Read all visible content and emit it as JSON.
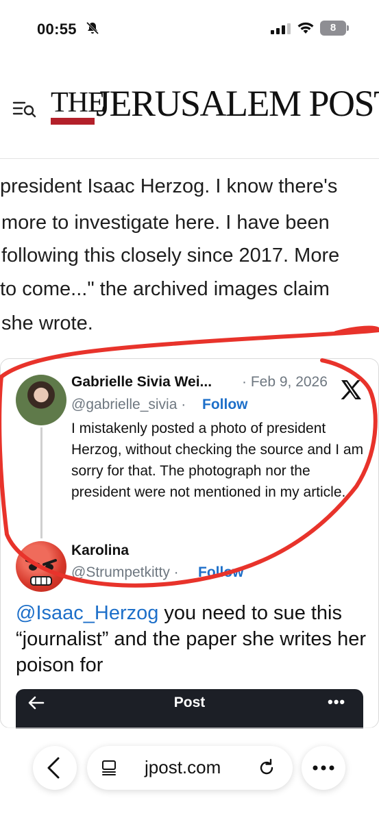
{
  "status_bar": {
    "time": "00:55",
    "battery": "8"
  },
  "header": {
    "logo_the": "THE",
    "logo_name": "JERUSALEM POST"
  },
  "article": {
    "lines": [
      "president Isaac Herzog. I know there's",
      "more to investigate here. I have been",
      "following this closely since 2017. More",
      "to come...\" the archived images claim",
      "she wrote."
    ]
  },
  "tweet": {
    "name": "Gabrielle Sivia Wei...",
    "date": "· Feb 9, 2026",
    "handle": "@gabrielle_sivia ·",
    "follow": "Follow",
    "text": "I mistakenly posted a photo of president Herzog, without checking the source and I am sorry for that. The photograph nor the president were not mentioned in my article."
  },
  "reply": {
    "name": "Karolina",
    "handle": "@Strumpetkitty ·",
    "follow": "Follow",
    "mention": "@Isaac_Herzog",
    "text": " you need to sue this “journalist” and the paper she writes her poison for",
    "nested_title": "Post"
  },
  "browser": {
    "url": "jpost.com"
  },
  "colors": {
    "link": "#1d6fc9",
    "logo_red": "#b3202a",
    "scribble": "#e8332b"
  }
}
